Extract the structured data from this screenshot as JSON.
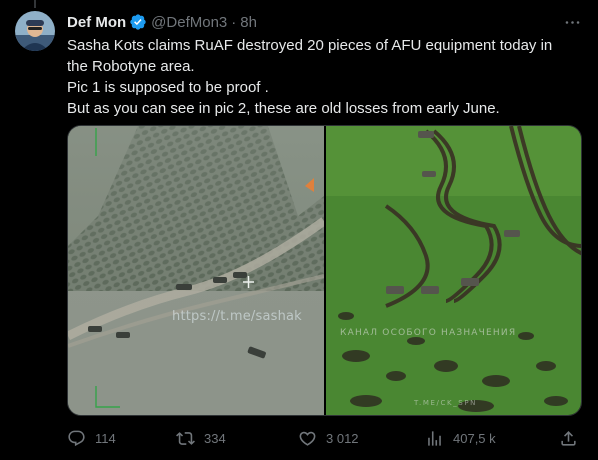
{
  "author": {
    "display_name": "Def Mon",
    "handle": "@DefMon3",
    "separator": "·",
    "time": "8h",
    "verified": true
  },
  "text_lines": [
    "Sasha Kots claims RuAF destroyed 20 pieces of AFU equipment today in",
    "the Robotyne area.",
    "Pic 1 is supposed to be proof .",
    "But as you can see in pic 2, these are old losses from early June."
  ],
  "media": {
    "left_watermark": "https://t.me/sashak",
    "right_caption": "КАНАЛ ОСОБОГО НАЗНАЧЕНИЯ",
    "right_footer": "T.ME/CK_SPN"
  },
  "actions": {
    "reply_count": "114",
    "retweet_count": "334",
    "like_count": "3 012",
    "views_count": "407,5 k"
  },
  "icons": {
    "verified": "verified-badge-icon",
    "more": "more-icon",
    "reply": "reply-icon",
    "retweet": "retweet-icon",
    "like": "like-icon",
    "views": "views-icon",
    "share": "share-icon"
  },
  "colors": {
    "background": "#000000",
    "text": "#e7e9ea",
    "secondary": "#71767b",
    "verified": "#1d9bf0"
  }
}
